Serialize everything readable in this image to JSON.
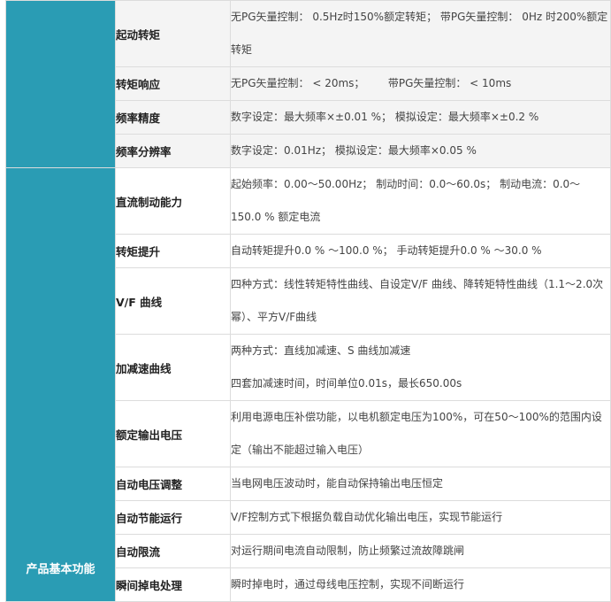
{
  "colors": {
    "group_bg": "#2a9cb4",
    "row_alt_bg": "#f4f4f4",
    "border": "#dcdcdc"
  },
  "group1": {
    "label": "",
    "rows": [
      {
        "name": "起动转矩",
        "value": "无PG矢量控制： 0.5Hz时150%额定转矩；  带PG矢量控制： 0Hz 时200%额定转矩"
      },
      {
        "name": "转矩响应",
        "value_a": "无PG矢量控制： < 20ms；",
        "value_b": "带PG矢量控制： < 10ms"
      },
      {
        "name": "频率精度",
        "value": "数字设定：最大频率×±0.01 %； 模拟设定：最大频率×±0.2 %"
      },
      {
        "name": "频率分辨率",
        "value": "数字设定：0.01Hz； 模拟设定：最大频率×0.05 %"
      }
    ]
  },
  "group2": {
    "label": "产品基本功能",
    "rows": [
      {
        "name": "直流制动能力",
        "value": "起始频率：0.00～50.00Hz； 制动时间：0.0～60.0s； 制动电流：0.0～150.0 % 额定电流"
      },
      {
        "name": "转矩提升",
        "value": "自动转矩提升0.0 % ～100.0 %； 手动转矩提升0.0 % ～30.0 %"
      },
      {
        "name": "V/F 曲线",
        "value": "四种方式：线性转矩特性曲线、自设定V/F 曲线、降转矩特性曲线（1.1～2.0次幂）、平方V/F曲线"
      },
      {
        "name": "加减速曲线",
        "line1": "两种方式：直线加减速、S 曲线加减速",
        "line2": "四套加减速时间，时间单位0.01s，最长650.00s"
      },
      {
        "name": "额定输出电压",
        "value": "利用电源电压补偿功能，以电机额定电压为100%，可在50～100%的范围内设定（输出不能超过输入电压）"
      },
      {
        "name": "自动电压调整",
        "value": "当电网电压波动时，能自动保持输出电压恒定"
      },
      {
        "name": "自动节能运行",
        "value": "V/F控制方式下根据负载自动优化输出电压，实现节能运行"
      },
      {
        "name": "自动限流",
        "value": "对运行期间电流自动限制，防止频繁过流故障跳闸"
      },
      {
        "name": "瞬间掉电处理",
        "value": "瞬时掉电时，通过母线电压控制，实现不间断运行"
      }
    ]
  }
}
